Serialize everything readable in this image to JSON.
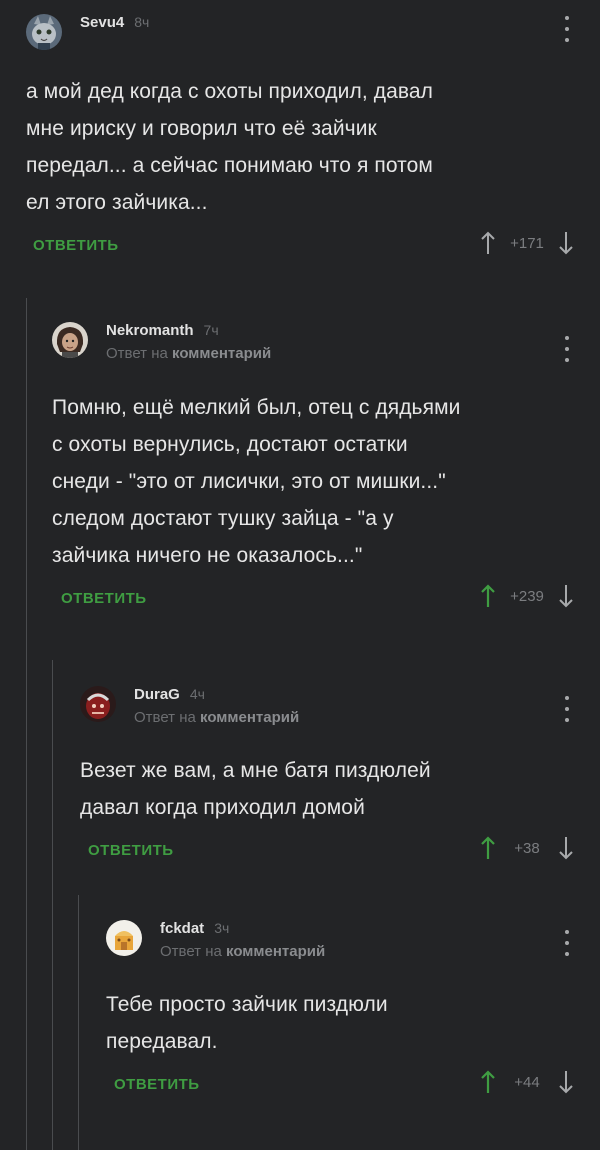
{
  "comments": [
    {
      "username": "Sevu4",
      "time": "8ч",
      "reply_prefix": "",
      "reply_target": "",
      "text": "а мой дед когда с охоты приходил, давал\nмне ириску и говорил что её зайчик\nпередал... а сейчас понимаю что я потом\nел этого зайчика...",
      "reply_label": "ОТВЕТИТЬ",
      "score": "+171",
      "upvoted": false
    },
    {
      "username": "Nekromanth",
      "time": "7ч",
      "reply_prefix": "Ответ на",
      "reply_target": "комментарий",
      "text": "Помню, ещё мелкий был, отец с дядьями\nс охоты вернулись, достают остатки\nснеди - \"это от лисички, это от мишки...\"\nследом достают тушку зайца - \"а у\nзайчика ничего не оказалось...\"",
      "reply_label": "ОТВЕТИТЬ",
      "score": "+239",
      "upvoted": true
    },
    {
      "username": "DuraG",
      "time": "4ч",
      "reply_prefix": "Ответ на",
      "reply_target": "комментарий",
      "text": "Везет же вам, а мне батя пиздюлей\nдавал когда приходил домой",
      "reply_label": "ОТВЕТИТЬ",
      "score": "+38",
      "upvoted": true
    },
    {
      "username": "fckdat",
      "time": "3ч",
      "reply_prefix": "Ответ на",
      "reply_target": "комментарий",
      "text": "Тебе просто зайчик пиздюли\nпередавал.",
      "reply_label": "ОТВЕТИТЬ",
      "score": "+44",
      "upvoted": true
    }
  ],
  "icons": {
    "more": "kebab-menu-icon",
    "upvote": "arrow-up-icon",
    "downvote": "arrow-down-icon"
  },
  "colors": {
    "background": "#232426",
    "accent_green": "#3f9d42",
    "muted": "#6c6e71"
  }
}
